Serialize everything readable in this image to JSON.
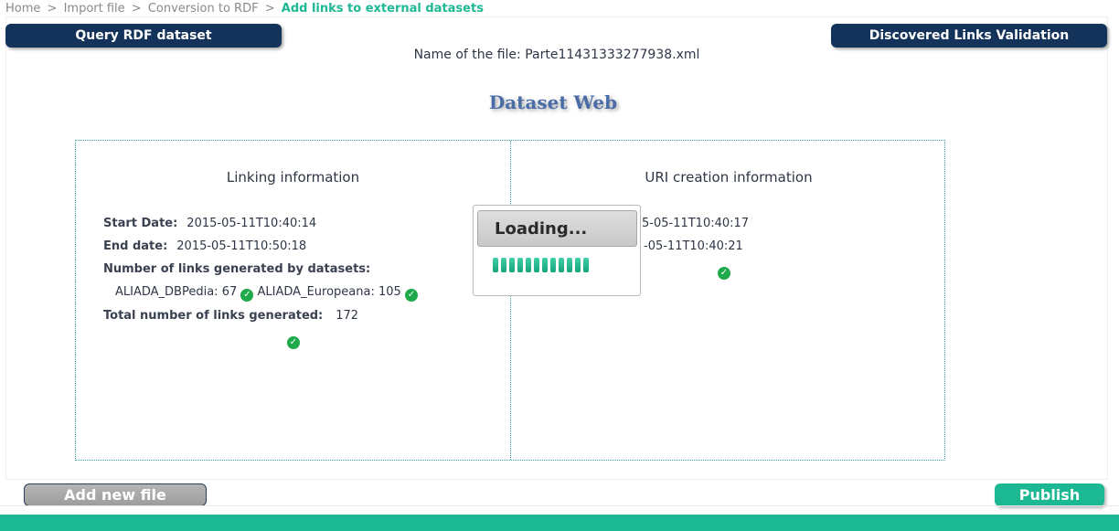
{
  "breadcrumb": {
    "items": [
      "Home",
      "Import file",
      "Conversion to RDF"
    ],
    "separator": ">",
    "current": "Add links to external datasets"
  },
  "nav": {
    "query_label": "Query RDF dataset",
    "links_validation_label": "Discovered Links Validation"
  },
  "file": {
    "name_label": "Name of the file:",
    "name_value": "Parte11431333277938.xml"
  },
  "dataset_title": "Dataset Web",
  "linking": {
    "title": "Linking information",
    "start_label": "Start Date:",
    "start_value": "2015-05-11T10:40:14",
    "end_label": "End date:",
    "end_value": "2015-05-11T10:50:18",
    "links_by_dataset_label": "Number of links generated by datasets:",
    "datasets": [
      {
        "name": "ALIADA_DBPedia:",
        "count": "67"
      },
      {
        "name": "ALIADA_Europeana:",
        "count": "105"
      }
    ],
    "total_label": "Total number of links generated:",
    "total_value": "172"
  },
  "uri": {
    "title": "URI creation information",
    "start_value_partial": "5-05-11T10:40:17",
    "end_value_partial": "-05-11T10:40:21"
  },
  "loading": {
    "label": "Loading...",
    "segments": 12
  },
  "actions": {
    "add_label": "Add new file",
    "publish_label": "Publish"
  },
  "icons": {
    "status": "check-circle-icon"
  },
  "colors": {
    "accent": "#1cb894",
    "nav": "#14335a",
    "title": "#4a6da8",
    "check": "#1ea94a"
  }
}
